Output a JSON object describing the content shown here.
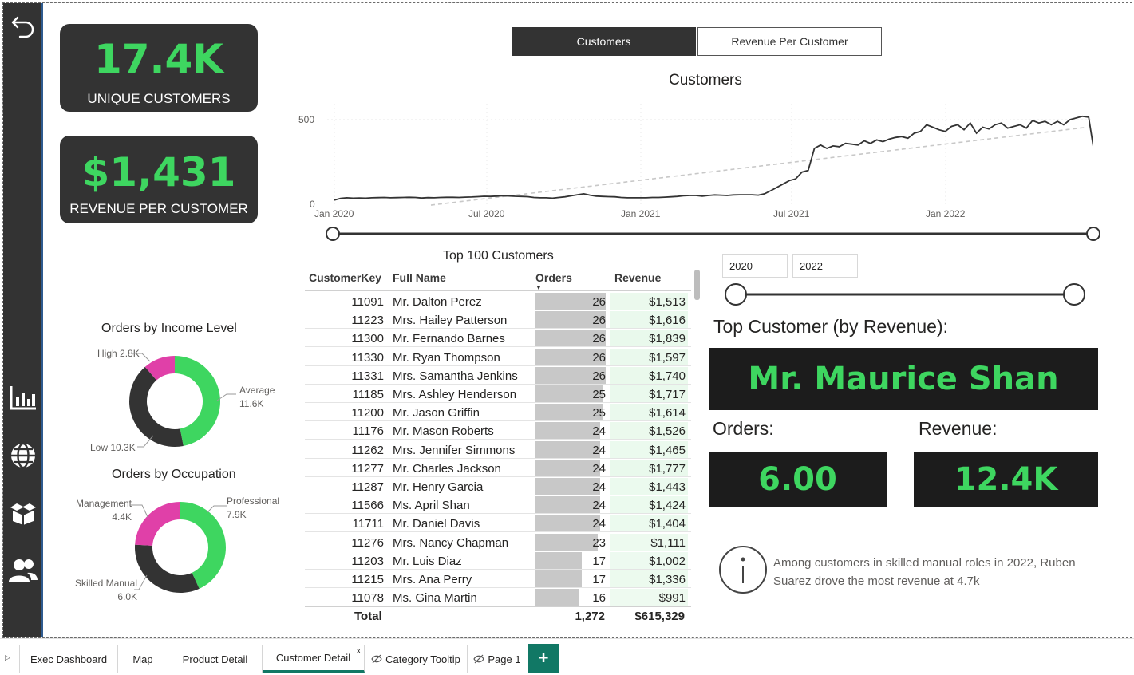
{
  "nav": {
    "back_icon": "back-arrow-icon",
    "items": [
      "bar-chart-icon",
      "globe-icon",
      "box-icon",
      "people-icon"
    ]
  },
  "kpis": {
    "unique_customers": {
      "value": "17.4K",
      "label": "UNIQUE CUSTOMERS"
    },
    "revenue_per_customer": {
      "value": "$1,431",
      "label": "REVENUE PER CUSTOMER"
    }
  },
  "toggle": {
    "active": "Customers",
    "inactive": "Revenue Per Customer"
  },
  "line_chart": {
    "title": "Customers",
    "y_ticks": [
      "500",
      "0"
    ],
    "x_ticks": [
      "Jan 2020",
      "Jul 2020",
      "Jan 2021",
      "Jul 2021",
      "Jan 2022"
    ]
  },
  "chart_data": {
    "type": "line",
    "title": "Customers",
    "xlabel": "",
    "ylabel": "",
    "ylim": [
      0,
      500
    ],
    "x_range": [
      "2020-01",
      "2022-06"
    ],
    "series": [
      {
        "values": [
          25,
          35,
          38,
          36,
          37,
          36,
          38,
          39,
          40,
          38,
          39,
          40,
          41,
          40,
          37,
          39,
          38,
          40,
          41,
          41,
          40,
          42,
          43,
          45,
          47,
          46,
          48,
          50,
          49,
          47,
          46,
          45,
          40,
          38,
          38,
          36,
          40,
          44,
          50,
          56,
          62,
          54,
          48,
          46,
          45,
          44,
          40,
          38,
          38,
          38,
          38,
          40,
          40,
          42,
          44,
          46,
          50,
          52,
          52,
          48,
          52,
          55,
          54,
          52,
          55,
          56,
          56,
          56,
          54,
          62,
          80,
          100,
          120,
          140,
          150,
          190,
          200,
          330,
          350,
          330,
          345,
          340,
          360,
          355,
          350,
          375,
          360,
          380,
          370,
          385,
          395,
          400,
          390,
          420,
          430,
          470,
          455,
          440,
          430,
          460,
          470,
          440,
          480,
          420,
          455,
          445,
          470,
          480,
          450,
          460,
          470,
          450,
          495,
          480,
          490,
          470,
          490,
          470,
          500,
          510,
          520,
          515,
          280
        ]
      },
      {
        "values": [
          -5,
          455
        ],
        "trend": true
      }
    ],
    "grid": true
  },
  "range_slider_top": {
    "start": "Jan 2020",
    "end": "Jun 2022"
  },
  "donut_income": {
    "title": "Orders by Income Level",
    "slices": [
      {
        "label": "Average",
        "value": "11.6K",
        "num": 11.6,
        "color": "#3ed660"
      },
      {
        "label": "Low",
        "value": "10.3K",
        "num": 10.3,
        "color": "#333333"
      },
      {
        "label": "High",
        "value": "2.8K",
        "num": 2.8,
        "color": "#e040a8"
      }
    ]
  },
  "donut_occupation": {
    "title": "Orders by Occupation",
    "slices": [
      {
        "label": "Professional",
        "value": "7.9K",
        "num": 7.9,
        "color": "#3ed660"
      },
      {
        "label": "Skilled Manual",
        "value": "6.0K",
        "num": 6.0,
        "color": "#333333"
      },
      {
        "label": "Management",
        "value": "4.4K",
        "num": 4.4,
        "color": "#e040a8"
      }
    ]
  },
  "table": {
    "title": "Top 100 Customers",
    "columns": [
      "CustomerKey",
      "Full Name",
      "Orders",
      "Revenue"
    ],
    "rows": [
      [
        "11091",
        "Mr. Dalton Perez",
        "26",
        "$1,513"
      ],
      [
        "11223",
        "Mrs. Hailey Patterson",
        "26",
        "$1,616"
      ],
      [
        "11300",
        "Mr. Fernando Barnes",
        "26",
        "$1,839"
      ],
      [
        "11330",
        "Mr. Ryan Thompson",
        "26",
        "$1,597"
      ],
      [
        "11331",
        "Mrs. Samantha Jenkins",
        "26",
        "$1,740"
      ],
      [
        "11185",
        "Mrs. Ashley Henderson",
        "25",
        "$1,717"
      ],
      [
        "11200",
        "Mr. Jason Griffin",
        "25",
        "$1,614"
      ],
      [
        "11176",
        "Mr. Mason Roberts",
        "24",
        "$1,526"
      ],
      [
        "11262",
        "Mrs. Jennifer Simmons",
        "24",
        "$1,465"
      ],
      [
        "11277",
        "Mr. Charles Jackson",
        "24",
        "$1,777"
      ],
      [
        "11287",
        "Mr. Henry Garcia",
        "24",
        "$1,443"
      ],
      [
        "11566",
        "Ms. April Shan",
        "24",
        "$1,424"
      ],
      [
        "11711",
        "Mr. Daniel Davis",
        "24",
        "$1,404"
      ],
      [
        "11276",
        "Mrs. Nancy Chapman",
        "23",
        "$1,111"
      ],
      [
        "11203",
        "Mr. Luis Diaz",
        "17",
        "$1,002"
      ],
      [
        "11215",
        "Mrs. Ana Perry",
        "17",
        "$1,336"
      ],
      [
        "11078",
        "Ms. Gina Martin",
        "16",
        "$991"
      ]
    ],
    "total_label": "Total",
    "total_orders": "1,272",
    "total_revenue": "$615,329"
  },
  "year_slicer": {
    "start": "2020",
    "end": "2022"
  },
  "top_customer": {
    "heading": "Top Customer (by Revenue):",
    "name": "Mr. Maurice Shan",
    "orders_label": "Orders:",
    "orders_value": "6.00",
    "revenue_label": "Revenue:",
    "revenue_value": "12.4K"
  },
  "insight": {
    "icon": "info-icon",
    "text_line1": "Among customers in skilled manual roles in 2022, Ruben",
    "text_line2": "Suarez drove the most revenue at 4.7k"
  },
  "page_tabs": {
    "items": [
      "Exec Dashboard",
      "Map",
      "Product Detail",
      "Customer Detail",
      "Category Tooltip",
      "Page 1"
    ],
    "active": "Customer Detail",
    "close_glyph": "x",
    "add_glyph": "+"
  },
  "colors": {
    "accent": "#3ed660",
    "dark": "#333333",
    "pink": "#e040a8",
    "tab_green": "#117865"
  }
}
